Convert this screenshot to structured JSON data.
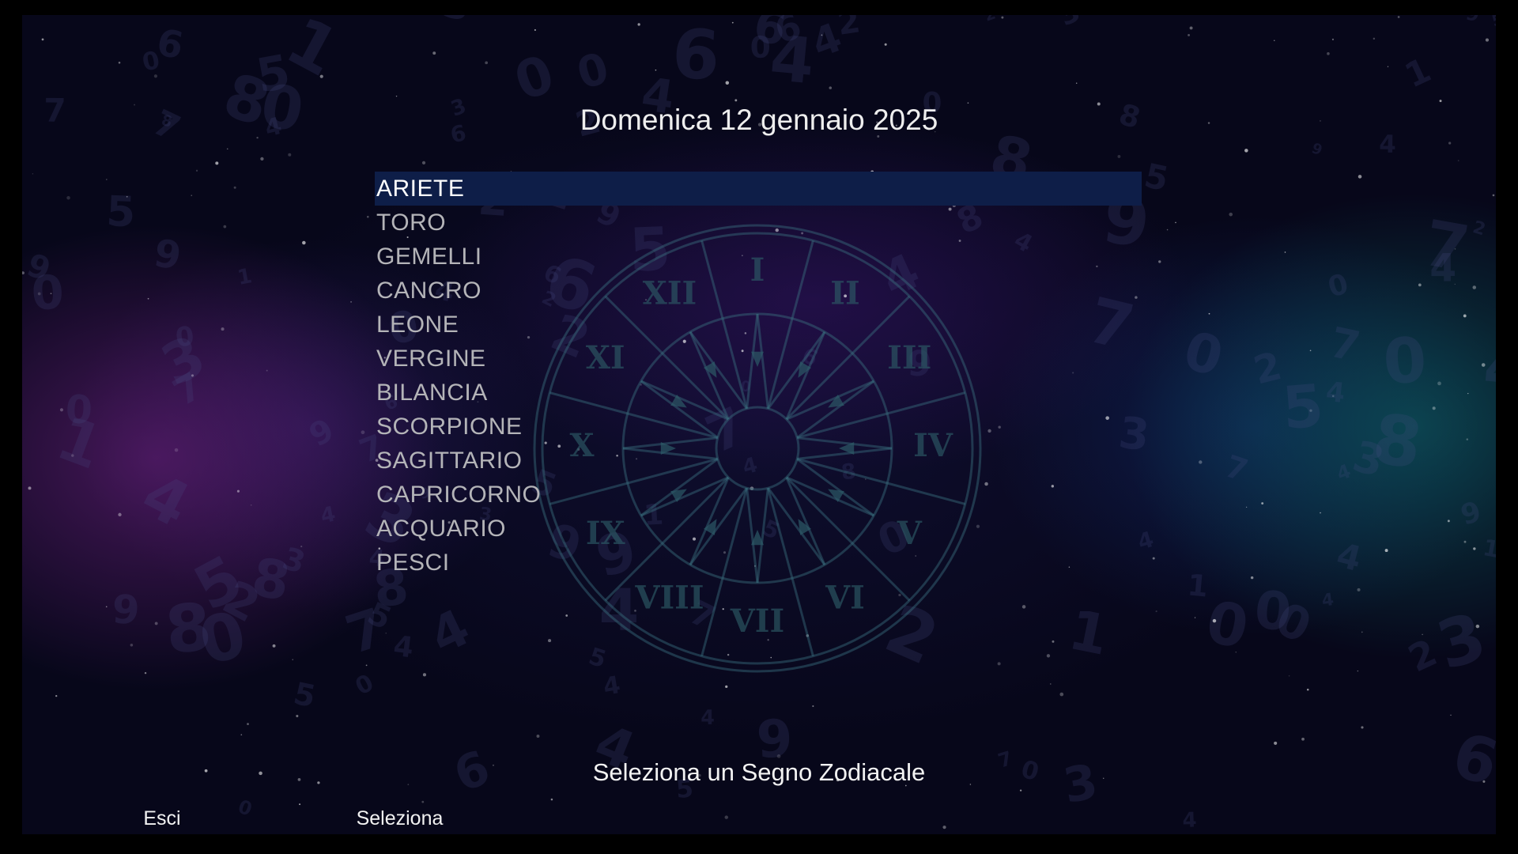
{
  "header": {
    "date": "Domenica 12 gennaio 2025"
  },
  "signs": {
    "selected_index": 0,
    "items": [
      {
        "label": "ARIETE"
      },
      {
        "label": "TORO"
      },
      {
        "label": "GEMELLI"
      },
      {
        "label": "CANCRO"
      },
      {
        "label": "LEONE"
      },
      {
        "label": "VERGINE"
      },
      {
        "label": "BILANCIA"
      },
      {
        "label": "SCORPIONE"
      },
      {
        "label": "SAGITTARIO"
      },
      {
        "label": "CAPRICORNO"
      },
      {
        "label": "ACQUARIO"
      },
      {
        "label": "PESCI"
      }
    ]
  },
  "footer": {
    "hint": "Seleziona un Segno Zodiacale",
    "keys": [
      {
        "label": "Esci",
        "color": "#e0141e",
        "icon": "red-key-bar"
      },
      {
        "label": "Seleziona",
        "color": "#22e04a",
        "icon": "green-key-bar"
      }
    ]
  },
  "background": {
    "wheel_numerals": [
      "I",
      "II",
      "III",
      "IV",
      "V",
      "VI",
      "VII",
      "VIII",
      "IX",
      "X",
      "XI",
      "XII"
    ]
  },
  "colors": {
    "selection": "#0e1e48",
    "text_selected": "#ffffff",
    "text_normal": "#b4b4b8"
  }
}
